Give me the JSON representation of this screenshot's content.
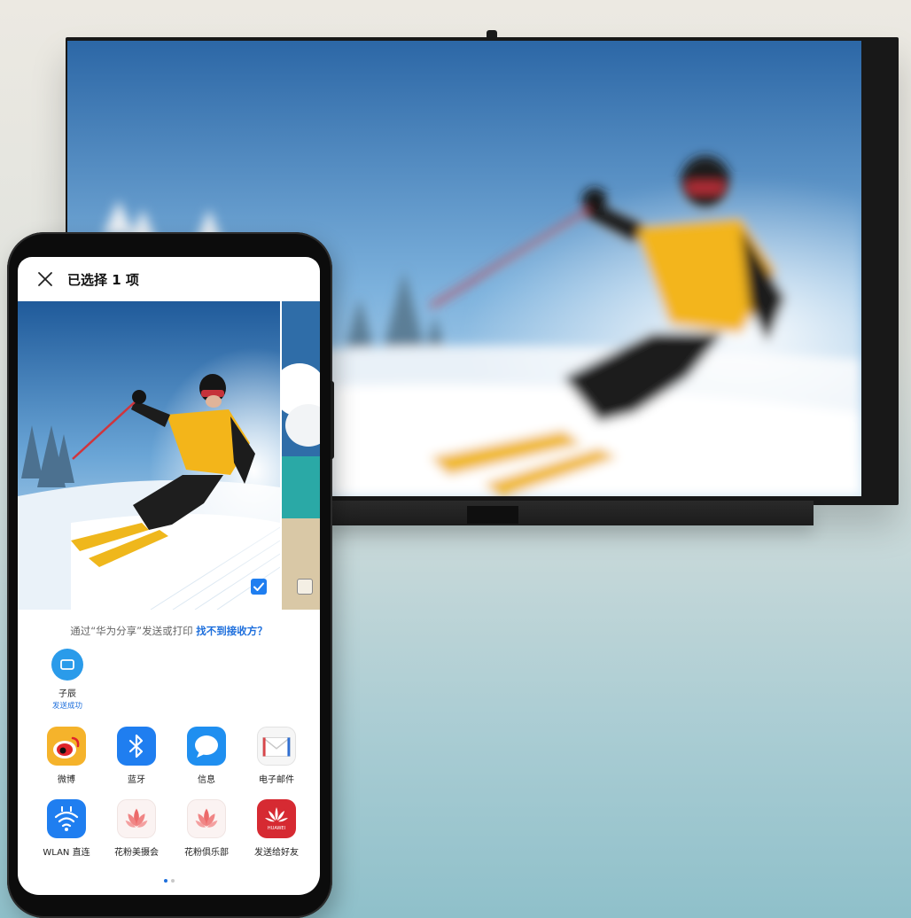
{
  "dialog": {
    "title": "已选择 1 项",
    "close_icon": "close-icon"
  },
  "photos": {
    "selected_checked": true,
    "next_checked": false
  },
  "share": {
    "hint_text": "通过“华为分享”发送或打印",
    "hint_link": "找不到接收方？"
  },
  "nearby_device": {
    "name": "子辰",
    "status": "发送成功",
    "icon": "tv-icon"
  },
  "apps": [
    {
      "label": "微博",
      "icon": "weibo-icon"
    },
    {
      "label": "蓝牙",
      "icon": "bluetooth-icon"
    },
    {
      "label": "信息",
      "icon": "message-icon"
    },
    {
      "label": "电子邮件",
      "icon": "email-icon"
    },
    {
      "label": "WLAN 直连",
      "icon": "wlan-direct-icon"
    },
    {
      "label": "花粉美摄会",
      "icon": "huafen-icon"
    },
    {
      "label": "花粉俱乐部",
      "icon": "huafen-club-icon"
    },
    {
      "label": "发送给好友",
      "icon": "huawei-icon"
    }
  ],
  "pagination": {
    "current": 1,
    "total": 2
  },
  "colors": {
    "accent": "#1e6fdc",
    "weibo": "#f5b32b",
    "bluetooth": "#1f7ef0",
    "message": "#1f8ff0",
    "wlan": "#1f7ef0",
    "huawei": "#d62a32"
  }
}
